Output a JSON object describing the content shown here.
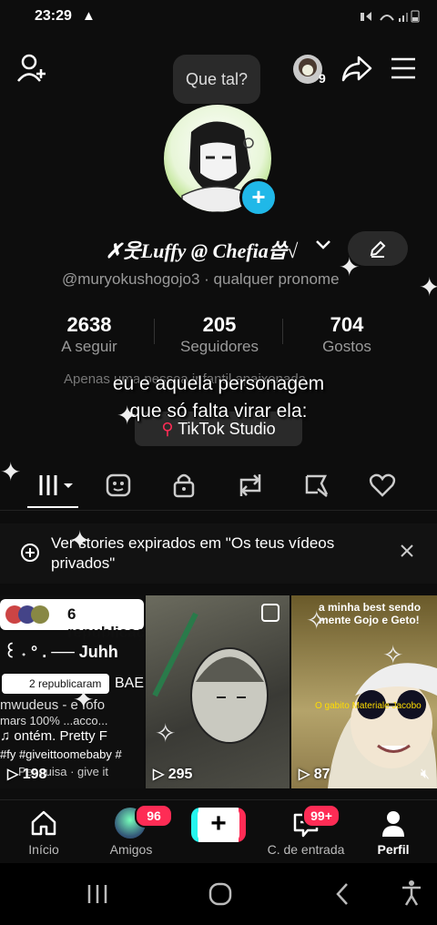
{
  "status_bar": {
    "time": "23:29"
  },
  "header": {
    "tooltip": "Que tal?",
    "friends_count": "9"
  },
  "profile": {
    "display_name": "✗웃Luffy @ Chefia씁√",
    "handle": "@muryokushogojo3 · qualquer pronome",
    "stats": [
      {
        "value": "2638",
        "label": "A seguir"
      },
      {
        "value": "205",
        "label": "Seguidores"
      },
      {
        "value": "704",
        "label": "Gostos"
      }
    ],
    "bio_faded": "Apenas uma pessoa infantil apaixonada",
    "studio_button": "TikTok Studio"
  },
  "overlay_caption": {
    "line1": "eu e aquela personagem",
    "line2": "que só falta virar ela:"
  },
  "tabs": [
    "videos",
    "favorites",
    "private",
    "reposts",
    "liked-hidden",
    "liked"
  ],
  "banner": {
    "text": "Ver stories expirados em \"Os teus vídeos privados\""
  },
  "grid": [
    {
      "views": "198",
      "pill1": "6 republicações",
      "line1": "꒰ ˖ ° . ── Juhh",
      "pill2": "2 republicaram",
      "line2": "BAE",
      "line3": "mwudeus - e fofo",
      "line4": "mars 100% ...acco...",
      "line5": "♫ ontém. Pretty F",
      "line6": "#fy #giveittoomebaby #",
      "line7": "Pesquisa · give it"
    },
    {
      "views": "295"
    },
    {
      "views": "87",
      "caption": "a minha best sendo mente Gojo e Geto!",
      "sub": "O gabito Materiale Jacobo"
    }
  ],
  "bottom_nav": [
    {
      "label": "Início"
    },
    {
      "label": "Amigos",
      "badge": "96"
    },
    {
      "label": ""
    },
    {
      "label": "C. de entrada",
      "badge": "99+"
    },
    {
      "label": "Perfil"
    }
  ],
  "colors": {
    "accent": "#fe2c55",
    "add_blue": "#20b8e8",
    "background": "#0d0d0d"
  }
}
